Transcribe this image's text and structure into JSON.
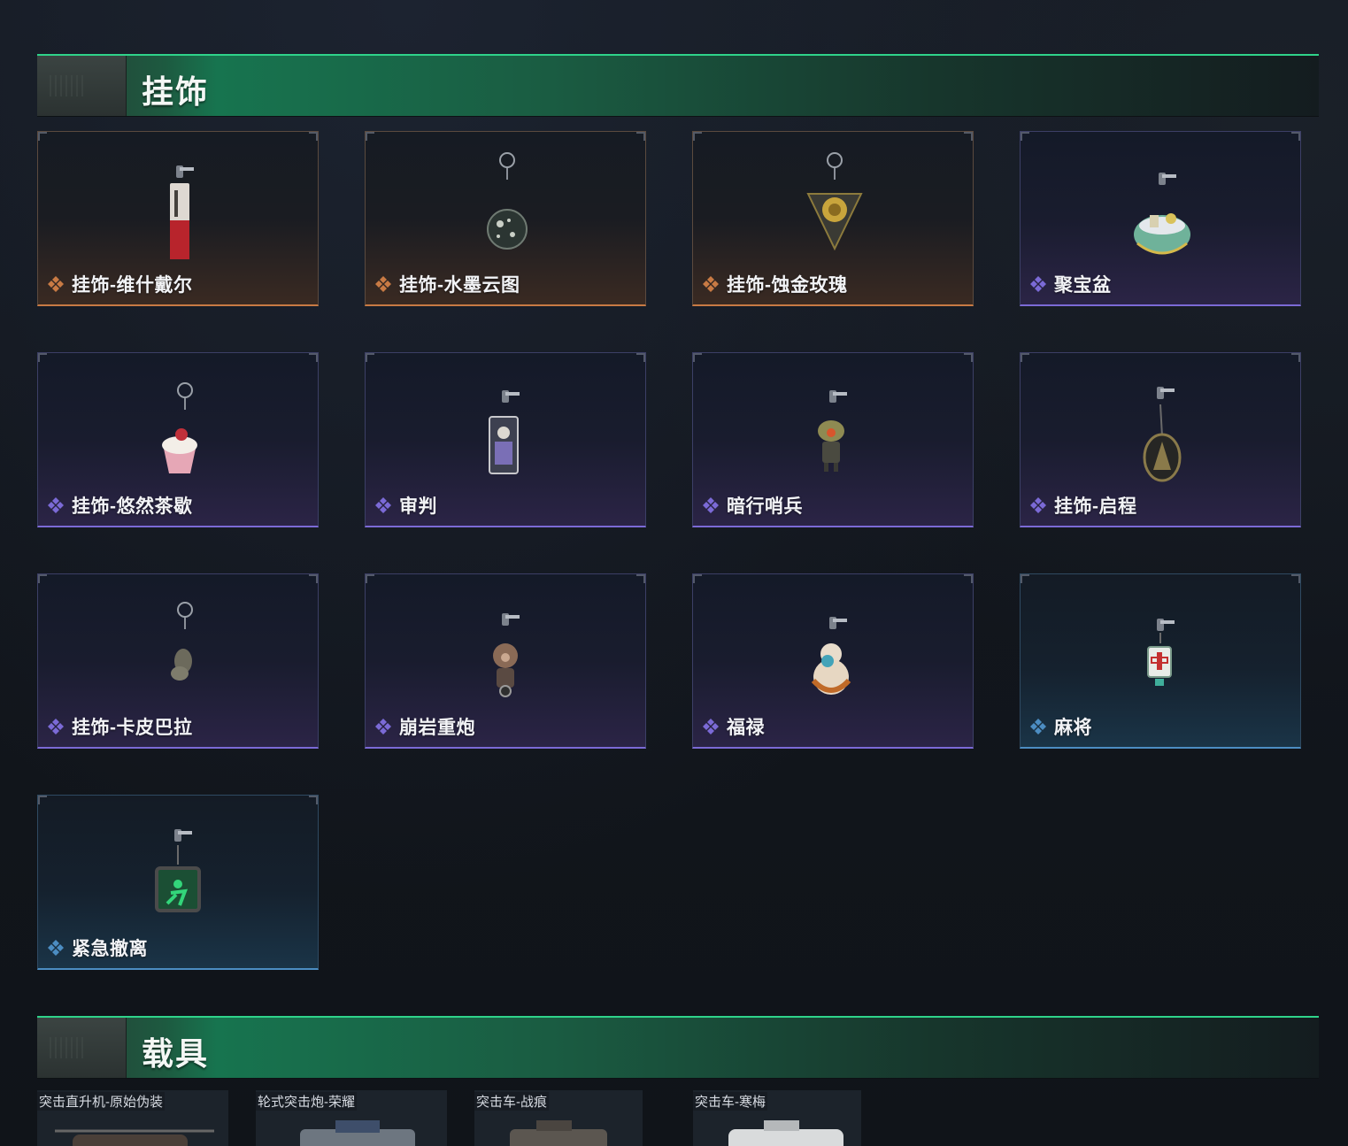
{
  "sections": {
    "charms": {
      "title": "挂饰"
    },
    "vehicles": {
      "title": "载具"
    }
  },
  "rarity_colors": {
    "orange": "#c87a44",
    "purple": "#7b6ad6",
    "blue": "#4c8dc2"
  },
  "charms": [
    {
      "name": "挂饰-维什戴尔",
      "rarity": "orange",
      "icon": "orange-diamond-icon",
      "art": "red-tag-charm"
    },
    {
      "name": "挂饰-水墨云图",
      "rarity": "orange",
      "icon": "orange-diamond-icon",
      "art": "ink-orb-charm"
    },
    {
      "name": "挂饰-蚀金玫瑰",
      "rarity": "orange",
      "icon": "orange-diamond-icon",
      "art": "gold-rose-charm"
    },
    {
      "name": "聚宝盆",
      "rarity": "purple",
      "icon": "purple-diamond-icon",
      "art": "treasure-bowl-charm"
    },
    {
      "name": "挂饰-悠然茶歇",
      "rarity": "purple",
      "icon": "purple-diamond-icon",
      "art": "cupcake-charm"
    },
    {
      "name": "审判",
      "rarity": "purple",
      "icon": "purple-diamond-icon",
      "art": "judge-card-charm"
    },
    {
      "name": "暗行哨兵",
      "rarity": "purple",
      "icon": "purple-diamond-icon",
      "art": "sentinel-figure-charm"
    },
    {
      "name": "挂饰-启程",
      "rarity": "purple",
      "icon": "purple-diamond-icon",
      "art": "badge-charm"
    },
    {
      "name": "挂饰-卡皮巴拉",
      "rarity": "purple",
      "icon": "purple-diamond-icon",
      "art": "capybara-charm"
    },
    {
      "name": "崩岩重炮",
      "rarity": "purple",
      "icon": "purple-diamond-icon",
      "art": "heavy-gunner-charm"
    },
    {
      "name": "福禄",
      "rarity": "purple",
      "icon": "purple-diamond-icon",
      "art": "gourd-charm"
    },
    {
      "name": "麻将",
      "rarity": "blue",
      "icon": "blue-diamond-icon",
      "art": "mahjong-tile-charm"
    },
    {
      "name": "紧急撤离",
      "rarity": "blue",
      "icon": "blue-diamond-icon",
      "art": "exit-sign-charm"
    }
  ],
  "vehicles": [
    {
      "name": "突击直升机-原始伪装"
    },
    {
      "name": "轮式突击炮-荣耀"
    },
    {
      "name": "突击车-战痕"
    },
    {
      "name": "突击车-寒梅"
    }
  ]
}
